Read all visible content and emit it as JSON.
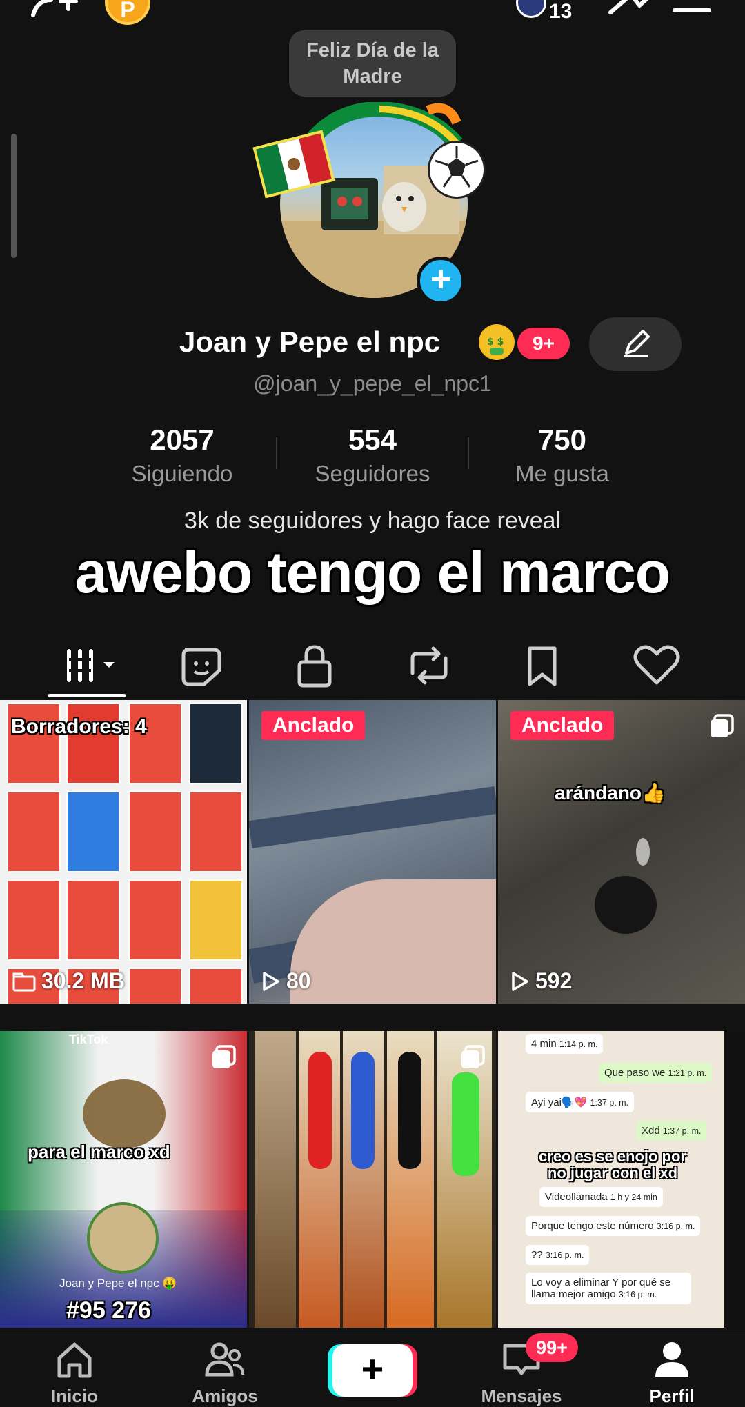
{
  "topbar": {
    "notif_count": "13"
  },
  "profile": {
    "status_note": "Feliz Día de la Madre",
    "display_name": "Joan y Pepe el npc",
    "badge": "9+",
    "username": "@joan_y_pepe_el_npc1",
    "stats": [
      {
        "value": "2057",
        "label": "Siguiendo"
      },
      {
        "value": "554",
        "label": "Seguidores"
      },
      {
        "value": "750",
        "label": "Me gusta"
      }
    ],
    "bio": "3k de seguidores y hago face reveal",
    "overlay_caption": "awebo tengo el marco"
  },
  "tabs": [
    "videos",
    "stickers",
    "private",
    "reposts",
    "saved",
    "liked"
  ],
  "grid": {
    "drafts_label": "Borradores: 4",
    "drafts_size": "30.2 MB",
    "pinned_label": "Anclado",
    "cells": [
      {
        "views": "80"
      },
      {
        "views": "592",
        "caption": "arándano👍"
      },
      {
        "caption": "para el marco xd",
        "footer": "Joan y Pepe el npc 🤑",
        "number": "#95 276",
        "watermark": "TikTok"
      },
      {},
      {
        "chat": [
          {
            "text": "4 min",
            "time": "1:14 p. m."
          },
          {
            "text": "Que paso we",
            "time": "1:21 p. m."
          },
          {
            "text": "Ayi yai🗣️💖",
            "time": "1:37 p. m."
          },
          {
            "text": "Xdd",
            "time": "1:37 p. m."
          },
          {
            "text": "Videollamada",
            "time": "1 h y 24 min"
          },
          {
            "text": "Porque tengo este número",
            "time": "3:16 p. m."
          },
          {
            "text": "??",
            "time": "3:16 p. m."
          },
          {
            "text": "Lo voy a eliminar Y por qué se llama mejor amigo",
            "time": "3:16 p. m."
          }
        ],
        "caption": "creo es se enojo por no jugar con el xd"
      }
    ]
  },
  "bottom_nav": {
    "items": [
      "Inicio",
      "Amigos",
      "",
      "Mensajes",
      "Perfil"
    ],
    "messages_badge": "99+"
  }
}
